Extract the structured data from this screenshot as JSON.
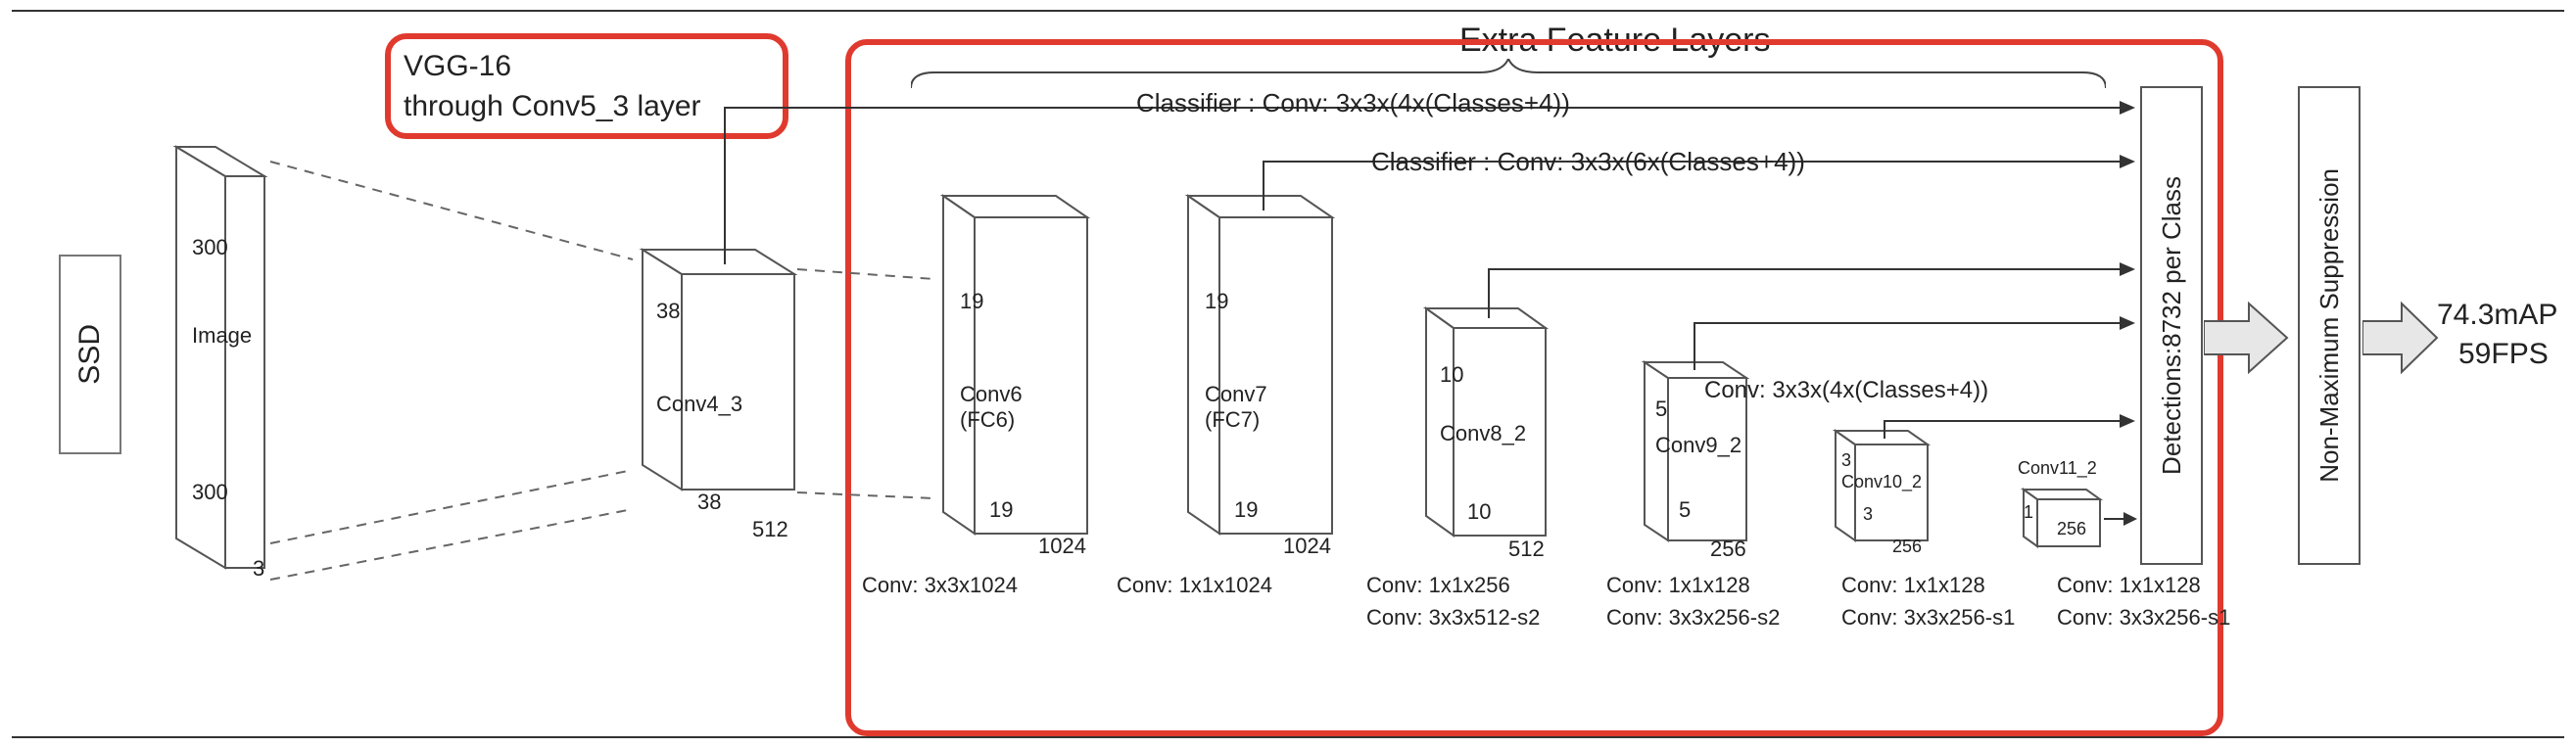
{
  "model_name": "SSD",
  "backbone_note": "VGG-16\nthrough Conv5_3 layer",
  "section_title": "Extra Feature Layers",
  "input": {
    "h": "300",
    "w": "300",
    "label": "Image",
    "c": "3"
  },
  "layers": {
    "conv4_3": {
      "name": "Conv4_3",
      "h": "38",
      "w": "38",
      "c": "512"
    },
    "conv6": {
      "name": "Conv6\n(FC6)",
      "h": "19",
      "w": "19",
      "c": "1024",
      "below": "Conv: 3x3x1024"
    },
    "conv7": {
      "name": "Conv7\n(FC7)",
      "h": "19",
      "w": "19",
      "c": "1024",
      "below": "Conv: 1x1x1024"
    },
    "conv8_2": {
      "name": "Conv8_2",
      "h": "10",
      "w": "10",
      "c": "512",
      "below1": "Conv: 1x1x256",
      "below2": "Conv:  3x3x512-s2"
    },
    "conv9_2": {
      "name": "Conv9_2",
      "h": "5",
      "w": "5",
      "c": "256",
      "below1": "Conv: 1x1x128",
      "below2": "Conv:  3x3x256-s2"
    },
    "conv10_2": {
      "name": "Conv10_2",
      "h": "3",
      "w": "3",
      "c": "256",
      "below1": "Conv: 1x1x128",
      "below2": "Conv:  3x3x256-s1"
    },
    "conv11_2": {
      "name": "Conv11_2",
      "h": "1",
      "w": "1",
      "c": "256",
      "below1": "Conv: 1x1x128",
      "below2": "Conv:  3x3x256-s1"
    }
  },
  "classifier1": "Classifier : Conv: 3x3x(4x(Classes+4))",
  "classifier2": "Classifier : Conv: 3x3x(6x(Classes+4))",
  "classifier3": "Conv: 3x3x(4x(Classes+4))",
  "detections_label": "Detections:8732  per Class",
  "nms_label": "Non-Maximum Suppression",
  "metric1": "74.3mAP",
  "metric2": "59FPS"
}
